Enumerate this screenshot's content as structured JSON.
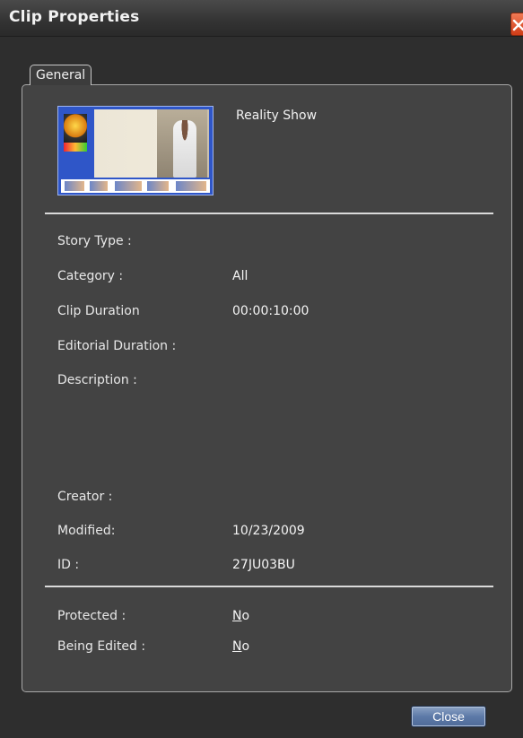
{
  "window": {
    "title": "Clip Properties"
  },
  "tabs": [
    {
      "label": "General"
    }
  ],
  "clip": {
    "name": "Reality Show"
  },
  "fields": {
    "story_type": {
      "label": "Story Type :",
      "value": ""
    },
    "category": {
      "label": "Category :",
      "value": "All"
    },
    "clip_duration": {
      "label": "Clip Duration",
      "value": "00:00:10:00"
    },
    "editorial_duration": {
      "label": "Editorial Duration :",
      "value": ""
    },
    "description": {
      "label": "Description :",
      "value": ""
    },
    "creator": {
      "label": "Creator :",
      "value": ""
    },
    "modified": {
      "label": "Modified:",
      "value": "10/23/2009"
    },
    "id": {
      "label": "ID :",
      "value": "27JU03BU"
    }
  },
  "status": {
    "protected": {
      "label": "Protected :",
      "value_mnemonic": "N",
      "value_rest": "o"
    },
    "being_edited": {
      "label": "Being Edited :",
      "value_mnemonic": "N",
      "value_rest": "o"
    }
  },
  "buttons": {
    "close": "Close"
  },
  "icons": {
    "window_close": "close-icon",
    "thumbnail": "clip-thumbnail"
  },
  "colors": {
    "window_bg": "#2e2e2e",
    "panel_bg": "#434343",
    "close_accent": "#d03c17",
    "button_accent": "#5d7aa8"
  }
}
